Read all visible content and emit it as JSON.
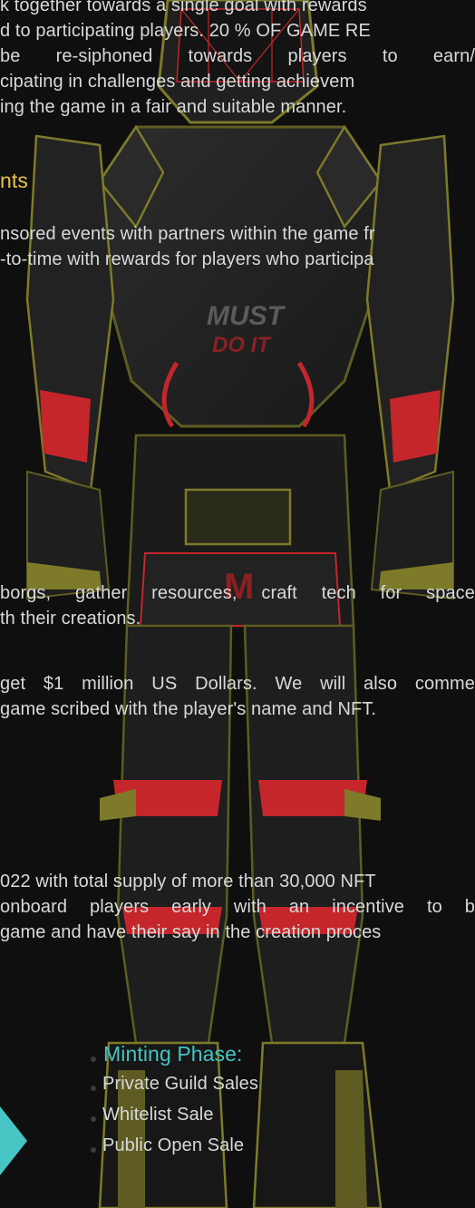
{
  "intro": {
    "line1": "k together towards a single goal with rewards",
    "line2": "d to participating players. 20 % OF GAME RE",
    "line3": " be re-siphoned towards players to earn/",
    "line4": "cipating in challenges and getting achievem",
    "line5": "ing the game in a fair and suitable manner."
  },
  "events": {
    "heading": "nts",
    "line1": "nsored events with partners within the game fr",
    "line2": "-to-time with rewards for players who participa"
  },
  "robot": {
    "chest_text_top": "MUST",
    "chest_text_bottom": "DO IT",
    "belt_letter": "M"
  },
  "craft": {
    "line1": "borgs, gather resources, craft tech for space",
    "line2": "th their creations."
  },
  "prize": {
    "line1": "get $1 million US Dollars. We will also comme",
    "line2": "game scribed with the player's name and NFT."
  },
  "supply": {
    "line1": "022 with total supply of more than 30,000 NFT",
    "line2": " onboard players early with an incentive to b",
    "line3": "game and have their say in the creation proces"
  },
  "minting": {
    "title": "Minting Phase:",
    "items": [
      "Private Guild Sales",
      "Whitelist Sale",
      "Public Open Sale"
    ]
  },
  "colors": {
    "heading_yellow": "#e7c24b",
    "accent_teal": "#45c3c4",
    "suit_red": "#c4262b",
    "suit_olive": "#7d7a2a"
  }
}
